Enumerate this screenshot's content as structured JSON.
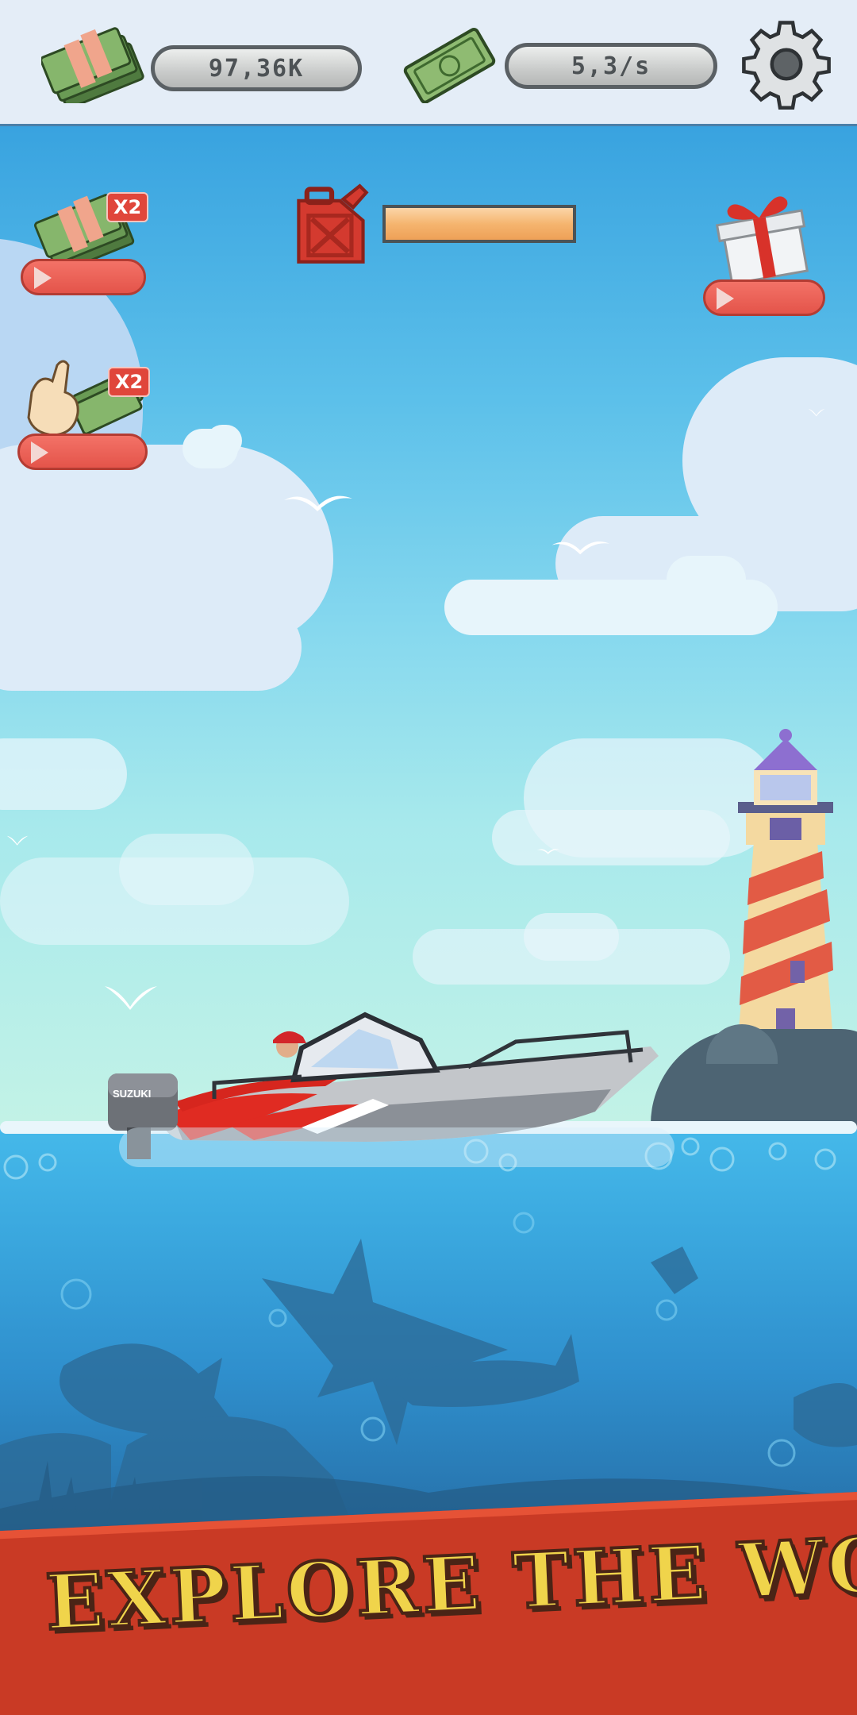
{
  "hud": {
    "money_icon": "cash-stack-icon",
    "money_value": "97,36K",
    "income_icon": "cash-bill-icon",
    "income_value": "5,3/s",
    "settings_icon": "gear-icon"
  },
  "boosts": {
    "cash_x2": {
      "badge": "X2",
      "icon": "cash-stack-icon",
      "button_icon": "play-icon"
    },
    "tap_x2": {
      "badge": "X2",
      "icon": "pointing-hand-cash-icon",
      "button_icon": "play-icon"
    },
    "gift": {
      "icon": "gift-box-icon",
      "button_icon": "play-icon"
    }
  },
  "fuel": {
    "icon": "fuel-can-icon",
    "level": 1.0,
    "color": "#f5b56f"
  },
  "boat": {
    "engine_brand": "SUZUKI"
  },
  "banner": {
    "text": "EXPLORE THE WORLD!"
  },
  "colors": {
    "banner_bg": "#c93a25",
    "banner_text": "#f0d44b",
    "button_red": "#e4544a"
  }
}
